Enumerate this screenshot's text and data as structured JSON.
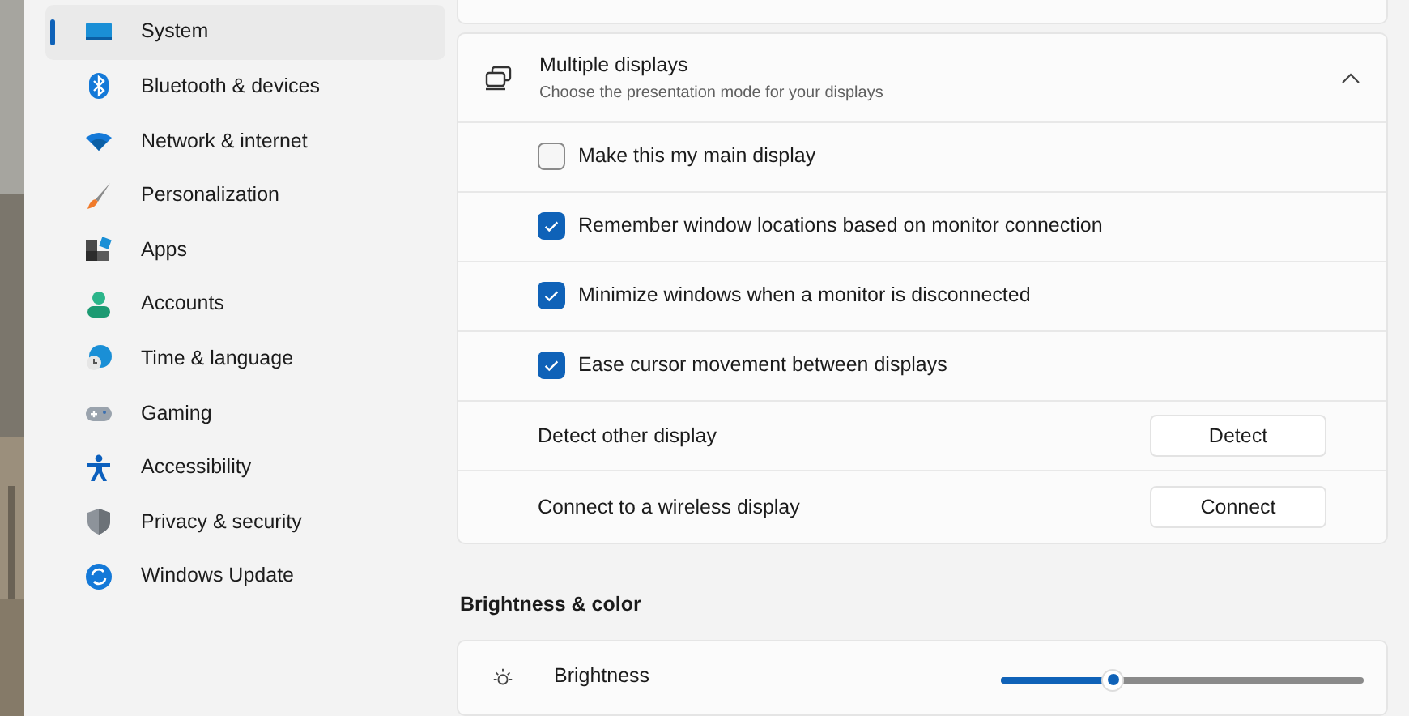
{
  "sidebar": {
    "items": [
      {
        "label": "System",
        "selected": true
      },
      {
        "label": "Bluetooth & devices",
        "selected": false
      },
      {
        "label": "Network & internet",
        "selected": false
      },
      {
        "label": "Personalization",
        "selected": false
      },
      {
        "label": "Apps",
        "selected": false
      },
      {
        "label": "Accounts",
        "selected": false
      },
      {
        "label": "Time & language",
        "selected": false
      },
      {
        "label": "Gaming",
        "selected": false
      },
      {
        "label": "Accessibility",
        "selected": false
      },
      {
        "label": "Privacy & security",
        "selected": false
      },
      {
        "label": "Windows Update",
        "selected": false
      }
    ]
  },
  "multiple_displays": {
    "title": "Multiple displays",
    "subtitle": "Choose the presentation mode for your displays",
    "expanded": true,
    "rows": [
      {
        "kind": "checkbox",
        "label": "Make this my main display",
        "checked": false
      },
      {
        "kind": "checkbox",
        "label": "Remember window locations based on monitor connection",
        "checked": true
      },
      {
        "kind": "checkbox",
        "label": "Minimize windows when a monitor is disconnected",
        "checked": true
      },
      {
        "kind": "checkbox",
        "label": "Ease cursor movement between displays",
        "checked": true
      },
      {
        "kind": "button",
        "label": "Detect other display",
        "button": "Detect"
      },
      {
        "kind": "button",
        "label": "Connect to a wireless display",
        "button": "Connect"
      }
    ]
  },
  "brightness_section": {
    "heading": "Brightness & color",
    "brightness": {
      "label": "Brightness",
      "level": 0.31
    }
  }
}
